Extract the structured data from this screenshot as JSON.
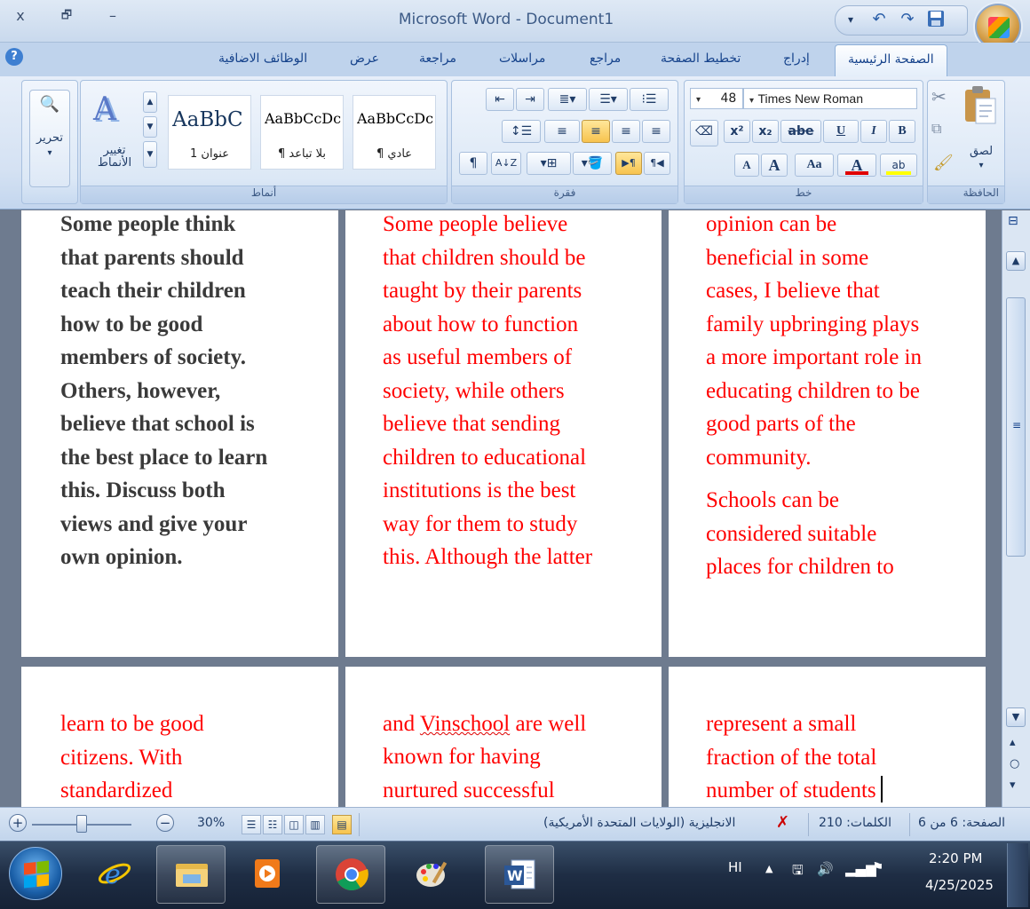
{
  "window": {
    "title": "Microsoft Word - Document1",
    "close_glyph": "x",
    "restore_glyph": "🗗",
    "minimize_glyph": "–"
  },
  "qat": {
    "dropdown": "▾",
    "undo": "↶",
    "redo": "↷",
    "save_icon": "floppy-disk-icon"
  },
  "tabs": [
    {
      "label": "الصفحة الرئيسية",
      "active": true
    },
    {
      "label": "إدراج"
    },
    {
      "label": "تخطيط الصفحة"
    },
    {
      "label": "مراجع"
    },
    {
      "label": "مراسلات"
    },
    {
      "label": "مراجعة"
    },
    {
      "label": "عرض"
    },
    {
      "label": "الوظائف الاضافية"
    }
  ],
  "ribbon": {
    "clipboard": {
      "label": "الحافظة",
      "paste": "لصق",
      "paste_arrow": "▾"
    },
    "font": {
      "label": "خط",
      "font_name": "Times New Roman",
      "font_size": "48",
      "bold": "B",
      "italic": "I",
      "underline": "U",
      "strike": "abe",
      "subscript": "x₂",
      "superscript": "x²",
      "change_case": "Aa",
      "font_color": "A",
      "grow": "A",
      "shrink": "A",
      "clear_format": "🧹",
      "highlight": "ab",
      "font_color_hex": "#e00000",
      "highlight_hex": "#ffff00"
    },
    "paragraph": {
      "label": "فقرة",
      "show_marks": "¶",
      "sort": "A↓Z",
      "ltr": "▶¶",
      "rtl": "¶◀"
    },
    "styles": {
      "label": "أنماط",
      "items": [
        {
          "preview": "AaBbCcDc",
          "name": "¶ عادي"
        },
        {
          "preview": "AaBbCcDc",
          "name": "¶ بلا تباعد"
        },
        {
          "preview": "AaBbC",
          "name": "عنوان 1"
        }
      ],
      "change_styles": "تغيير\nالأنماط"
    },
    "editing": {
      "label": "تحرير",
      "arrow": "▾"
    }
  },
  "document": {
    "pages": [
      {
        "text": "Some people think\nthat parents should\nteach their children\nhow to be good\nmembers of society.\nOthers, however,\nbelieve that school is\nthe best place to learn\nthis. Discuss both\nviews and give your\nown opinion."
      },
      {
        "text": "Some people believe\nthat children should be\ntaught by their parents\nabout how to function\nas useful members of\nsociety, while others\nbelieve that sending\nchildren to educational\ninstitutions is the best\nway for them to study\nthis. Although the latter"
      },
      {
        "text": "opinion can be\nbeneficial in some\ncases, I believe that\nfamily upbringing plays\na more important role in\neducating children to be\ngood parts of the\ncommunity.",
        "text2": "Schools can be\nconsidered suitable\nplaces for children to"
      },
      {
        "text": "learn to be good\ncitizens. With\nstandardized"
      },
      {
        "line1a": "and ",
        "line1b": "Vinschool",
        "line1c": " are well",
        "rest": "known for having\nnurtured successful"
      },
      {
        "text": "represent a small\nfraction of the total\nnumber of students"
      }
    ]
  },
  "statusbar": {
    "zoom": "30%",
    "zoom_fraction": 0.45,
    "language": "الانجليزية (الولايات المتحدة الأمريكية)",
    "words": "الكلمات: 210",
    "page": "الصفحة: 6 من 6"
  },
  "taskbar": {
    "items": [
      {
        "name": "ie",
        "running": false
      },
      {
        "name": "explorer",
        "running": true
      },
      {
        "name": "media",
        "running": false
      },
      {
        "name": "chrome",
        "running": true
      },
      {
        "name": "paint",
        "running": false
      },
      {
        "name": "word",
        "running": true
      }
    ],
    "lang": "HI",
    "time": "2:20 PM",
    "date": "4/25/2025"
  }
}
